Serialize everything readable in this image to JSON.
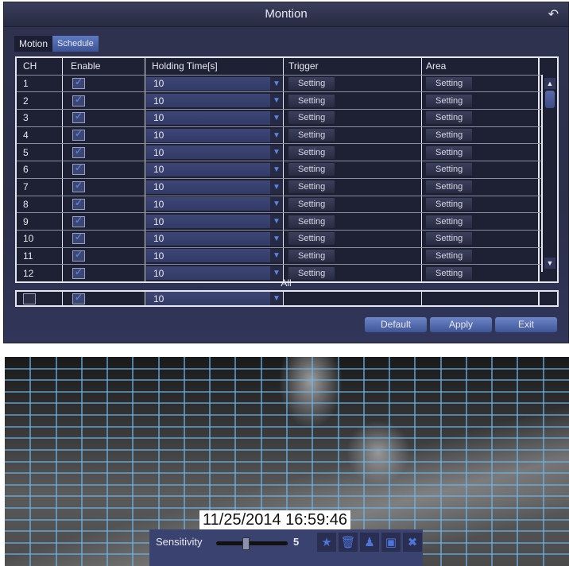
{
  "window": {
    "title": "Montion",
    "back_icon": "return-arrow"
  },
  "tabs": [
    {
      "label": "Motion",
      "active": false
    },
    {
      "label": "Schedule",
      "active": true
    }
  ],
  "table": {
    "headers": [
      "CH",
      "Enable",
      "Holding Time[s]",
      "Trigger",
      "Area"
    ],
    "rows": [
      {
        "ch": "1",
        "enabled": true,
        "holding": "10",
        "trigger": "Setting",
        "area": "Setting"
      },
      {
        "ch": "2",
        "enabled": true,
        "holding": "10",
        "trigger": "Setting",
        "area": "Setting"
      },
      {
        "ch": "3",
        "enabled": true,
        "holding": "10",
        "trigger": "Setting",
        "area": "Setting"
      },
      {
        "ch": "4",
        "enabled": true,
        "holding": "10",
        "trigger": "Setting",
        "area": "Setting"
      },
      {
        "ch": "5",
        "enabled": true,
        "holding": "10",
        "trigger": "Setting",
        "area": "Setting"
      },
      {
        "ch": "6",
        "enabled": true,
        "holding": "10",
        "trigger": "Setting",
        "area": "Setting"
      },
      {
        "ch": "7",
        "enabled": true,
        "holding": "10",
        "trigger": "Setting",
        "area": "Setting"
      },
      {
        "ch": "8",
        "enabled": true,
        "holding": "10",
        "trigger": "Setting",
        "area": "Setting"
      },
      {
        "ch": "9",
        "enabled": true,
        "holding": "10",
        "trigger": "Setting",
        "area": "Setting"
      },
      {
        "ch": "10",
        "enabled": true,
        "holding": "10",
        "trigger": "Setting",
        "area": "Setting"
      },
      {
        "ch": "11",
        "enabled": true,
        "holding": "10",
        "trigger": "Setting",
        "area": "Setting"
      },
      {
        "ch": "12",
        "enabled": true,
        "holding": "10",
        "trigger": "Setting",
        "area": "Setting"
      }
    ]
  },
  "all": {
    "label": "All",
    "select_all": false,
    "enabled": true,
    "holding": "10"
  },
  "buttons": {
    "default": "Default",
    "apply": "Apply",
    "exit": "Exit"
  },
  "camera": {
    "timestamp": "11/25/2014   16:59:46",
    "sensitivity_label": "Sensitivity",
    "sensitivity_value": "5",
    "sensitivity_fraction": 0.4,
    "grid_color": "#6cb4e8",
    "grid_cols": 22,
    "grid_rows": 18,
    "tool_icons": [
      "select-all-icon",
      "clear-icon",
      "person-icon",
      "save-icon",
      "close-icon"
    ]
  }
}
